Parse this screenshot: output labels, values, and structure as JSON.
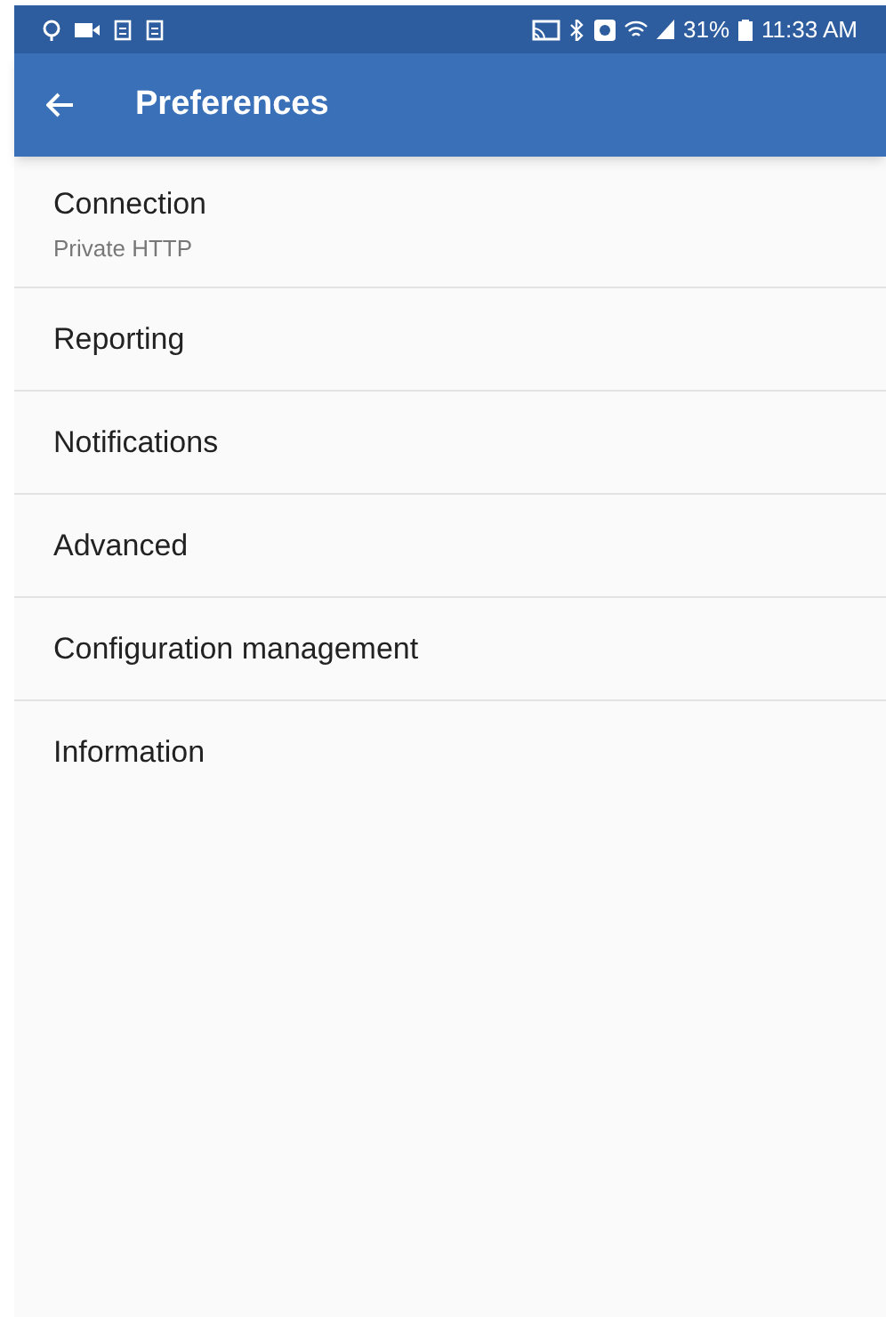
{
  "status_bar": {
    "battery": "31%",
    "time": "11:33 AM"
  },
  "app_bar": {
    "title": "Preferences"
  },
  "items": [
    {
      "title": "Connection",
      "summary": "Private HTTP"
    },
    {
      "title": "Reporting"
    },
    {
      "title": "Notifications"
    },
    {
      "title": "Advanced"
    },
    {
      "title": "Configuration management"
    },
    {
      "title": "Information"
    }
  ]
}
